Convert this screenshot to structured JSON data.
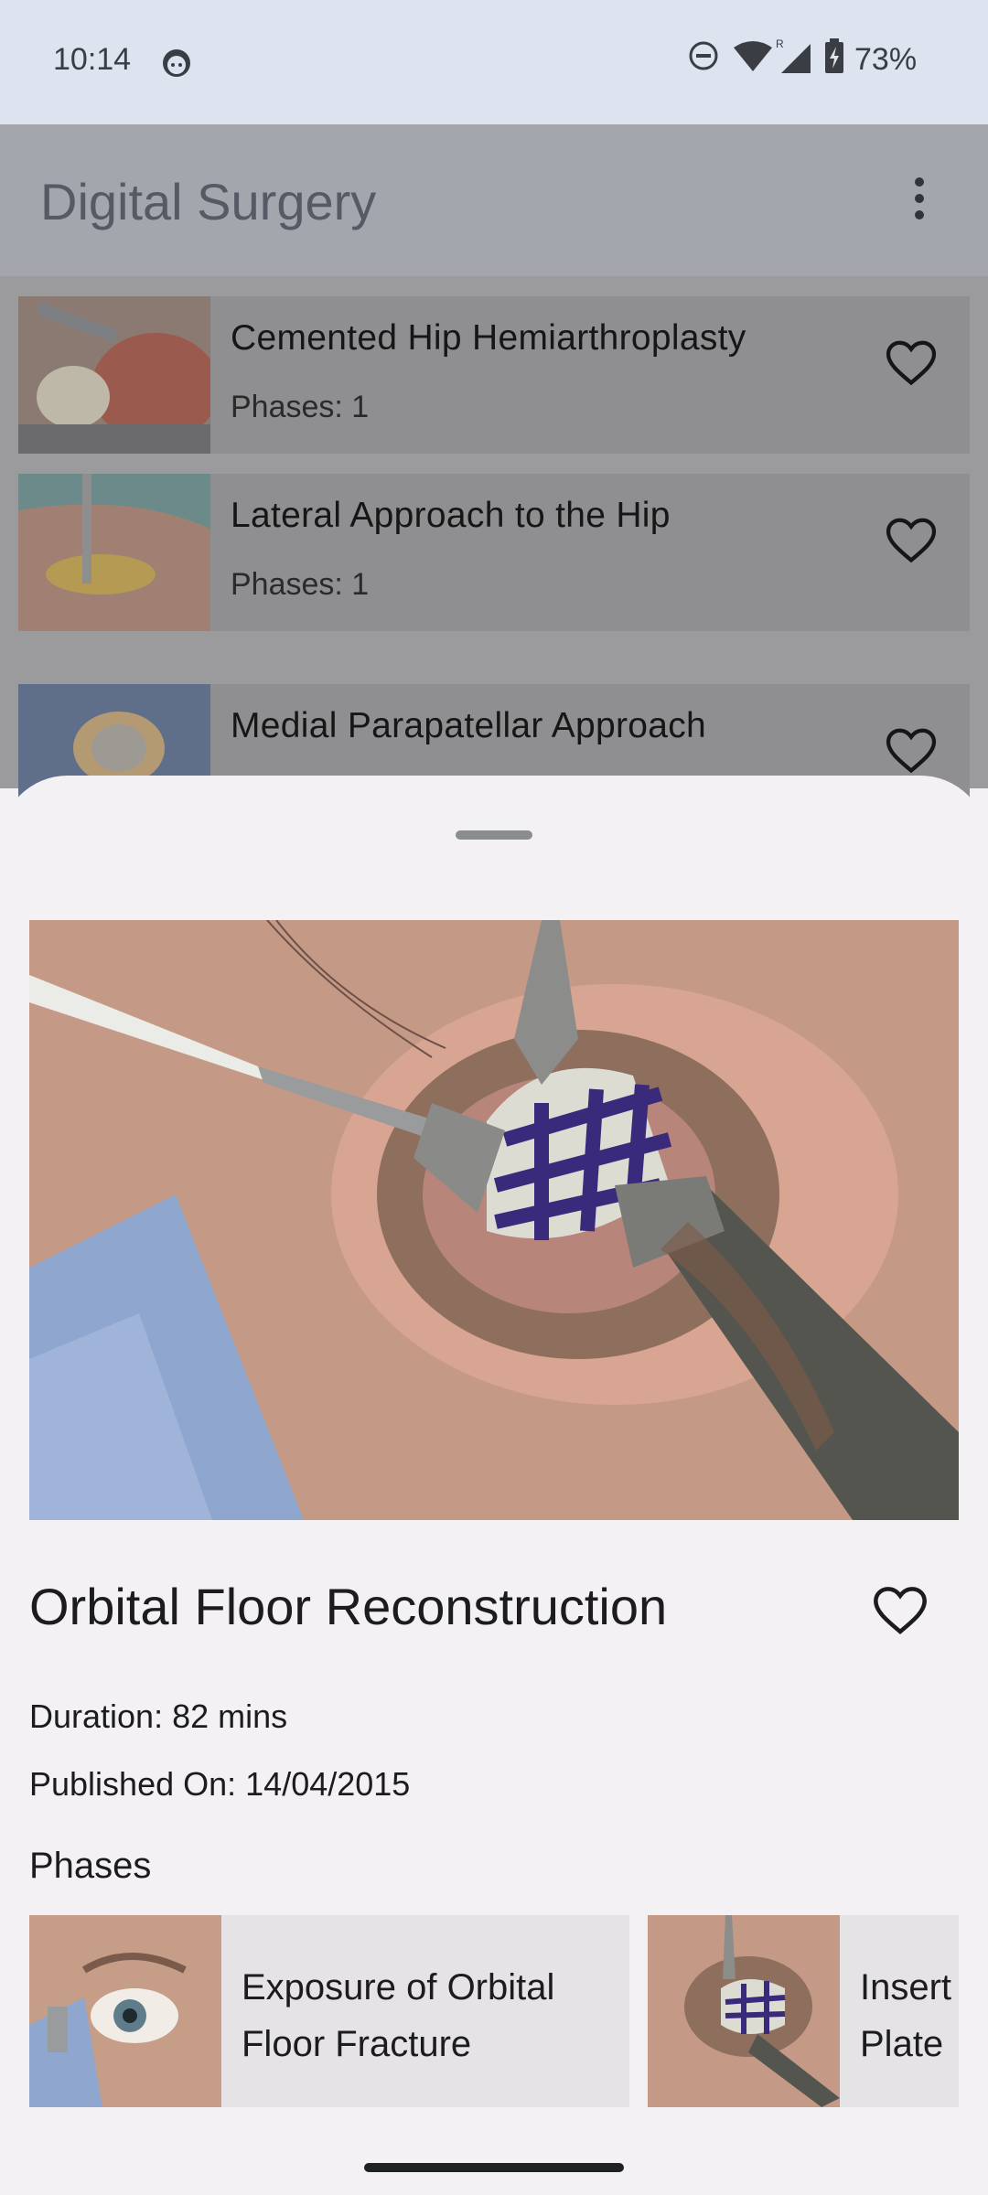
{
  "status_bar": {
    "time": "10:14",
    "battery": "73%",
    "icons": [
      "face-icon",
      "dnd-icon",
      "wifi-icon",
      "signal-roaming-icon",
      "battery-charging-icon"
    ]
  },
  "app_bar": {
    "title": "Digital Surgery",
    "menu_icon": "more-vert-icon"
  },
  "procedures": [
    {
      "title": "Cemented Hip Hemiarthroplasty",
      "phases": "Phases: 1"
    },
    {
      "title": "Lateral Approach to the Hip",
      "phases": "Phases: 1"
    },
    {
      "title": "Medial Parapatellar Approach",
      "phases": ""
    }
  ],
  "detail": {
    "title": "Orbital Floor Reconstruction",
    "duration": "Duration: 82 mins",
    "published": "Published On: 14/04/2015",
    "phases_heading": "Phases",
    "phases": [
      {
        "label": "Exposure of Orbital Floor Fracture"
      },
      {
        "label": "Insert Plate"
      }
    ]
  },
  "colors": {
    "scrim": "#9b9b9e",
    "sheet": "#f3f1f4",
    "card": "#e5e3e6",
    "accent_text": "#1c1b1f"
  }
}
